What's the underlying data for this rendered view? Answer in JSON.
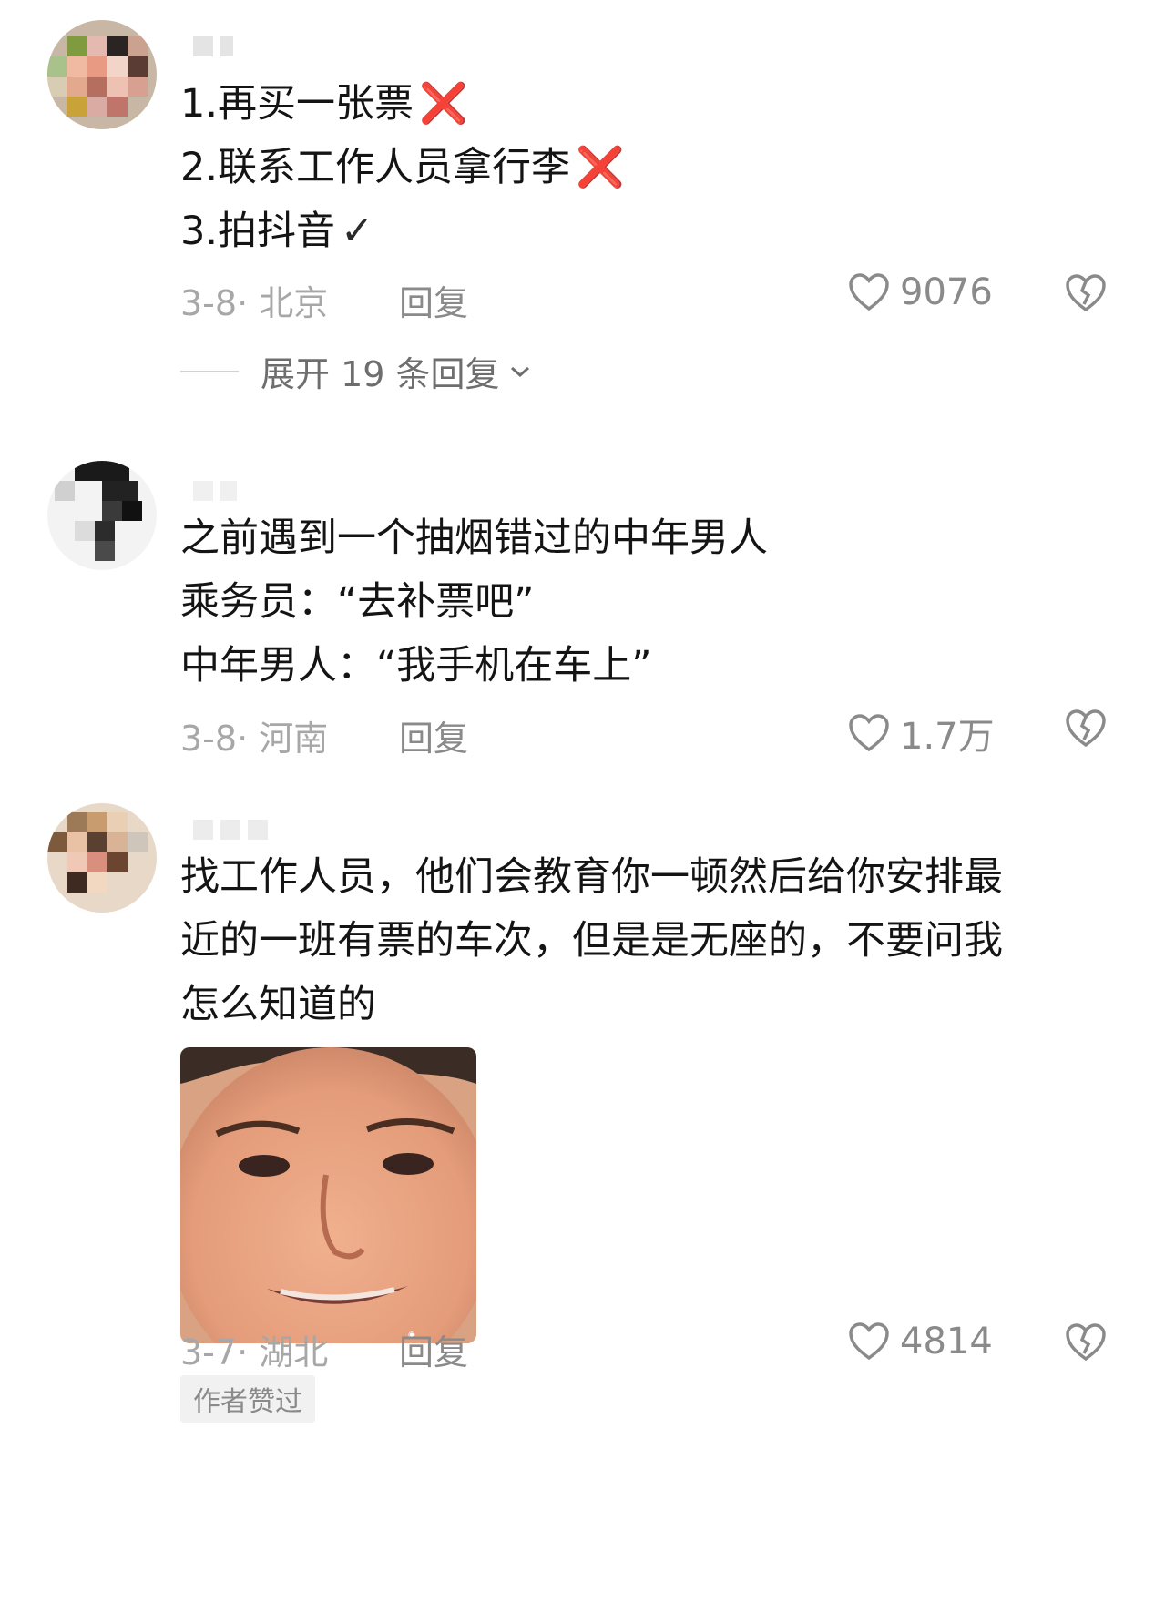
{
  "comments": [
    {
      "lines": [
        "1.再买一张票",
        "2.联系工作人员拿行李",
        "3.拍抖音"
      ],
      "marks": [
        "❌",
        "❌",
        "✓"
      ],
      "meta": "3-8· 北京",
      "reply_label": "回复",
      "likes": "9076",
      "expand_label": "展开 19 条回复"
    },
    {
      "lines": [
        "之前遇到一个抽烟错过的中年男人",
        "乘务员：“去补票吧”",
        "中年男人：“我手机在车上”"
      ],
      "meta": "3-8· 河南",
      "reply_label": "回复",
      "likes": "1.7万"
    },
    {
      "lines": [
        "找工作人员，他们会教育你一顿然后给你安排最",
        "近的一班有票的车次，但是是无座的，不要问我",
        "怎么知道的"
      ],
      "meta": "3-7· 湖北",
      "reply_label": "回复",
      "likes": "4814",
      "author_badge": "作者赞过"
    }
  ],
  "colors": {
    "cross": "#e5141a",
    "muted_text": "#a7a7a7",
    "icon": "#8a8a8a"
  }
}
